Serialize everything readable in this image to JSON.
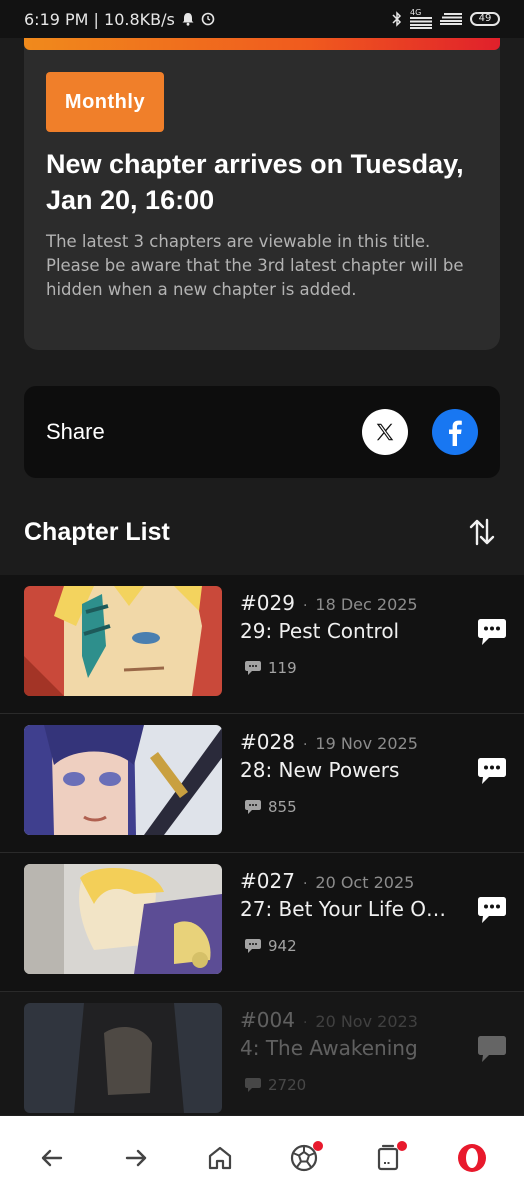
{
  "status_bar": {
    "time_speed": "6:19 PM | 10.8KB/s",
    "network": "4G",
    "battery": "49"
  },
  "release_card": {
    "badge": "Monthly",
    "headline": "New chapter arrives on Tuesday, Jan 20, 16:00",
    "description": "The latest 3 chapters are viewable in this title. Please be aware that the 3rd latest chapter will be hidden when a new chapter is added."
  },
  "share": {
    "label": "Share"
  },
  "chapter_list": {
    "title": "Chapter List",
    "chapters": [
      {
        "number": "#029",
        "date": "18 Dec 2025",
        "title": "29: Pest Control",
        "comments": "119"
      },
      {
        "number": "#028",
        "date": "19 Nov 2025",
        "title": "28: New Powers",
        "comments": "855"
      },
      {
        "number": "#027",
        "date": "20 Oct 2025",
        "title": "27: Bet Your Life On...",
        "comments": "942"
      },
      {
        "number": "#004",
        "date": "20 Nov 2023",
        "title": "4: The Awakening",
        "comments": "2720"
      }
    ]
  },
  "colors": {
    "accent": "#f07f2a",
    "gradient_end": "#e0202b",
    "facebook": "#1877f2",
    "badge_dot": "#e8192c"
  }
}
